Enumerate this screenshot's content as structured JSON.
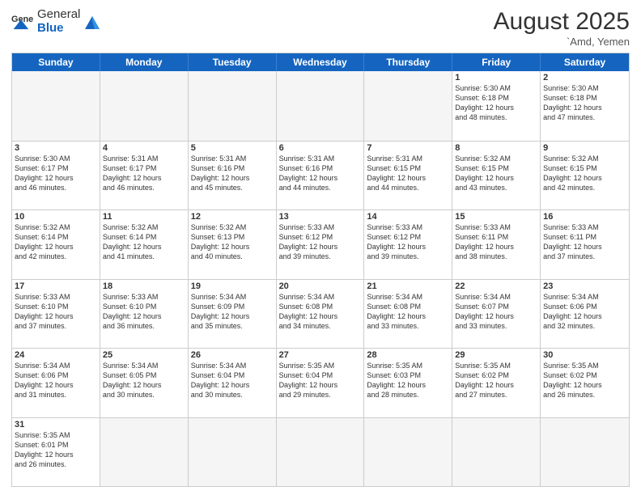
{
  "logo": {
    "general": "General",
    "blue": "Blue"
  },
  "header": {
    "month_year": "August 2025",
    "location": "`Amd, Yemen"
  },
  "day_headers": [
    "Sunday",
    "Monday",
    "Tuesday",
    "Wednesday",
    "Thursday",
    "Friday",
    "Saturday"
  ],
  "weeks": [
    [
      {
        "date": "",
        "info": "",
        "empty": true
      },
      {
        "date": "",
        "info": "",
        "empty": true
      },
      {
        "date": "",
        "info": "",
        "empty": true
      },
      {
        "date": "",
        "info": "",
        "empty": true
      },
      {
        "date": "",
        "info": "",
        "empty": true
      },
      {
        "date": "1",
        "info": "Sunrise: 5:30 AM\nSunset: 6:18 PM\nDaylight: 12 hours\nand 48 minutes."
      },
      {
        "date": "2",
        "info": "Sunrise: 5:30 AM\nSunset: 6:18 PM\nDaylight: 12 hours\nand 47 minutes."
      }
    ],
    [
      {
        "date": "3",
        "info": "Sunrise: 5:30 AM\nSunset: 6:17 PM\nDaylight: 12 hours\nand 46 minutes."
      },
      {
        "date": "4",
        "info": "Sunrise: 5:31 AM\nSunset: 6:17 PM\nDaylight: 12 hours\nand 46 minutes."
      },
      {
        "date": "5",
        "info": "Sunrise: 5:31 AM\nSunset: 6:16 PM\nDaylight: 12 hours\nand 45 minutes."
      },
      {
        "date": "6",
        "info": "Sunrise: 5:31 AM\nSunset: 6:16 PM\nDaylight: 12 hours\nand 44 minutes."
      },
      {
        "date": "7",
        "info": "Sunrise: 5:31 AM\nSunset: 6:15 PM\nDaylight: 12 hours\nand 44 minutes."
      },
      {
        "date": "8",
        "info": "Sunrise: 5:32 AM\nSunset: 6:15 PM\nDaylight: 12 hours\nand 43 minutes."
      },
      {
        "date": "9",
        "info": "Sunrise: 5:32 AM\nSunset: 6:15 PM\nDaylight: 12 hours\nand 42 minutes."
      }
    ],
    [
      {
        "date": "10",
        "info": "Sunrise: 5:32 AM\nSunset: 6:14 PM\nDaylight: 12 hours\nand 42 minutes."
      },
      {
        "date": "11",
        "info": "Sunrise: 5:32 AM\nSunset: 6:14 PM\nDaylight: 12 hours\nand 41 minutes."
      },
      {
        "date": "12",
        "info": "Sunrise: 5:32 AM\nSunset: 6:13 PM\nDaylight: 12 hours\nand 40 minutes."
      },
      {
        "date": "13",
        "info": "Sunrise: 5:33 AM\nSunset: 6:12 PM\nDaylight: 12 hours\nand 39 minutes."
      },
      {
        "date": "14",
        "info": "Sunrise: 5:33 AM\nSunset: 6:12 PM\nDaylight: 12 hours\nand 39 minutes."
      },
      {
        "date": "15",
        "info": "Sunrise: 5:33 AM\nSunset: 6:11 PM\nDaylight: 12 hours\nand 38 minutes."
      },
      {
        "date": "16",
        "info": "Sunrise: 5:33 AM\nSunset: 6:11 PM\nDaylight: 12 hours\nand 37 minutes."
      }
    ],
    [
      {
        "date": "17",
        "info": "Sunrise: 5:33 AM\nSunset: 6:10 PM\nDaylight: 12 hours\nand 37 minutes."
      },
      {
        "date": "18",
        "info": "Sunrise: 5:33 AM\nSunset: 6:10 PM\nDaylight: 12 hours\nand 36 minutes."
      },
      {
        "date": "19",
        "info": "Sunrise: 5:34 AM\nSunset: 6:09 PM\nDaylight: 12 hours\nand 35 minutes."
      },
      {
        "date": "20",
        "info": "Sunrise: 5:34 AM\nSunset: 6:08 PM\nDaylight: 12 hours\nand 34 minutes."
      },
      {
        "date": "21",
        "info": "Sunrise: 5:34 AM\nSunset: 6:08 PM\nDaylight: 12 hours\nand 33 minutes."
      },
      {
        "date": "22",
        "info": "Sunrise: 5:34 AM\nSunset: 6:07 PM\nDaylight: 12 hours\nand 33 minutes."
      },
      {
        "date": "23",
        "info": "Sunrise: 5:34 AM\nSunset: 6:06 PM\nDaylight: 12 hours\nand 32 minutes."
      }
    ],
    [
      {
        "date": "24",
        "info": "Sunrise: 5:34 AM\nSunset: 6:06 PM\nDaylight: 12 hours\nand 31 minutes."
      },
      {
        "date": "25",
        "info": "Sunrise: 5:34 AM\nSunset: 6:05 PM\nDaylight: 12 hours\nand 30 minutes."
      },
      {
        "date": "26",
        "info": "Sunrise: 5:34 AM\nSunset: 6:04 PM\nDaylight: 12 hours\nand 30 minutes."
      },
      {
        "date": "27",
        "info": "Sunrise: 5:35 AM\nSunset: 6:04 PM\nDaylight: 12 hours\nand 29 minutes."
      },
      {
        "date": "28",
        "info": "Sunrise: 5:35 AM\nSunset: 6:03 PM\nDaylight: 12 hours\nand 28 minutes."
      },
      {
        "date": "29",
        "info": "Sunrise: 5:35 AM\nSunset: 6:02 PM\nDaylight: 12 hours\nand 27 minutes."
      },
      {
        "date": "30",
        "info": "Sunrise: 5:35 AM\nSunset: 6:02 PM\nDaylight: 12 hours\nand 26 minutes."
      }
    ],
    [
      {
        "date": "31",
        "info": "Sunrise: 5:35 AM\nSunset: 6:01 PM\nDaylight: 12 hours\nand 26 minutes."
      },
      {
        "date": "",
        "info": "",
        "empty": true
      },
      {
        "date": "",
        "info": "",
        "empty": true
      },
      {
        "date": "",
        "info": "",
        "empty": true
      },
      {
        "date": "",
        "info": "",
        "empty": true
      },
      {
        "date": "",
        "info": "",
        "empty": true
      },
      {
        "date": "",
        "info": "",
        "empty": true
      }
    ]
  ],
  "colors": {
    "header_blue": "#1565c0",
    "empty_bg": "#f5f5f5",
    "border": "#cccccc"
  }
}
